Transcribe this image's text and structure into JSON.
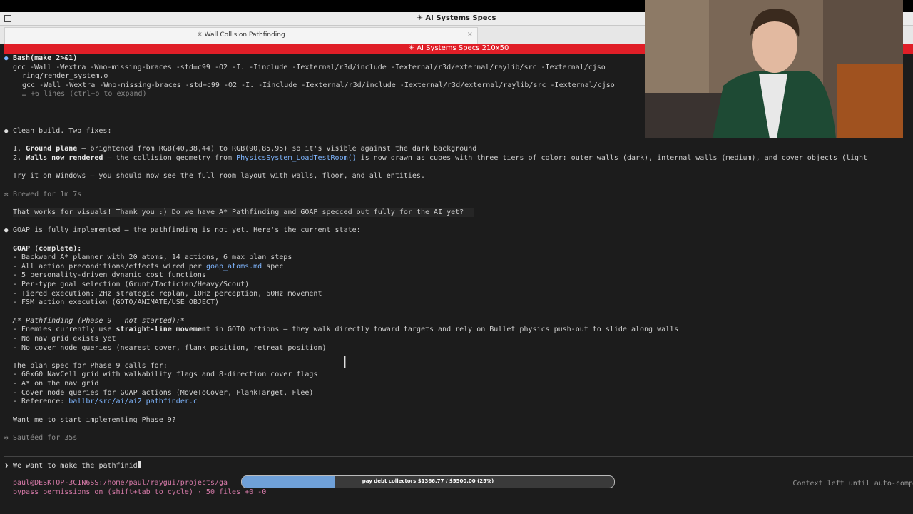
{
  "window": {
    "title": "✳ AI Systems Specs"
  },
  "tab": {
    "label": "✳ Wall Collision Pathfinding",
    "close": "×"
  },
  "terminal_header": "✳ AI Systems Specs 210x50",
  "lines": {
    "l1_bash": "Bash(make 2>&1)",
    "l2": "gcc -Wall -Wextra -Wno-missing-braces -std=c99 -O2 -I. -Iinclude -Iexternal/r3d/include -Iexternal/r3d/external/raylib/src -Iexternal/cjso",
    "l3": "ring/render_system.o",
    "l4": "gcc -Wall -Wextra -Wno-missing-braces -std=c99 -O2 -I. -Iinclude -Iexternal/r3d/include -Iexternal/r3d/external/raylib/src -Iexternal/cjso",
    "l5": "… +6 lines (ctrl+o to expand)",
    "clean": "Clean build. Two fixes:",
    "fix1_a": "1. ",
    "fix1_b": "Ground plane",
    "fix1_c": " — brightened from RGB(40,38,44) to RGB(90,85,95) so it's visible against the dark background",
    "fix2_a": "2. ",
    "fix2_b": "Walls now rendered",
    "fix2_c": " — the collision geometry from ",
    "fix2_d": "PhysicsSystem_LoadTestRoom()",
    "fix2_e": " is now drawn as cubes with three tiers of color: outer walls (dark), internal walls (medium), and cover objects (light",
    "try": "Try it on Windows — you should now see the full room layout with walls, floor, and all entities.",
    "brewed": "Brewed for 1m 7s",
    "user_msg": "That works for visuals! Thank you :) Do we have A* Pathfinding and GOAP specced out fully for the AI yet?",
    "goap_state": "GOAP is fully implemented — the pathfinding is not yet. Here's the current state:",
    "goap_head": "GOAP (complete):",
    "g1": "- Backward A* planner with 20 atoms, 14 actions, 6 max plan steps",
    "g2_a": "- All action preconditions/effects wired per ",
    "g2_b": "goap_atoms.md",
    "g2_c": " spec",
    "g3": "- 5 personality-driven dynamic cost functions",
    "g4": "- Per-type goal selection (Grunt/Tactician/Heavy/Scout)",
    "g5": "- Tiered execution: 2Hz strategic replan, 10Hz perception, 60Hz movement",
    "g6": "- FSM action execution (GOTO/ANIMATE/USE_OBJECT)",
    "astar_head": "A* Pathfinding (Phase 9 — not started):*",
    "a1_a": "- Enemies currently use ",
    "a1_b": "straight-line movement",
    "a1_c": " in GOTO actions — they walk directly toward targets and rely on Bullet physics push-out to slide along walls",
    "a2": "- No nav grid exists yet",
    "a3": "- No cover node queries (nearest cover, flank position, retreat position)",
    "plan": "The plan spec for Phase 9 calls for:",
    "p1": "- 60x60 NavCell grid with walkability flags and 8-direction cover flags",
    "p2": "- A* on the nav grid",
    "p3": "- Cover node queries for GOAP actions (MoveToCover, FlankTarget, Flee)",
    "p4_a": "- Reference: ",
    "p4_b": "ballbr/src/ai/ai2_pathfinder.c",
    "want": "Want me to start implementing Phase 9?",
    "sauteed": "Sautéed for 35s"
  },
  "prompt": {
    "chevron": "❯",
    "text": " We want to make the pathfinid"
  },
  "status": {
    "path": "paul@DESKTOP-3C1N6SS:/home/paul/raygui/projects/ga",
    "bypass": "bypass permissions on (shift+tab to cycle) · 50 files +0 -0",
    "context": "Context left until auto-comp"
  },
  "progress": {
    "label": "pay debt collectors $1366.77 / $5500.00 (25%)",
    "fraction": 0.25
  },
  "colors": {
    "accent_red": "#e01e27",
    "link_blue": "#7fb6ff",
    "status_pink": "#d77aa9"
  }
}
